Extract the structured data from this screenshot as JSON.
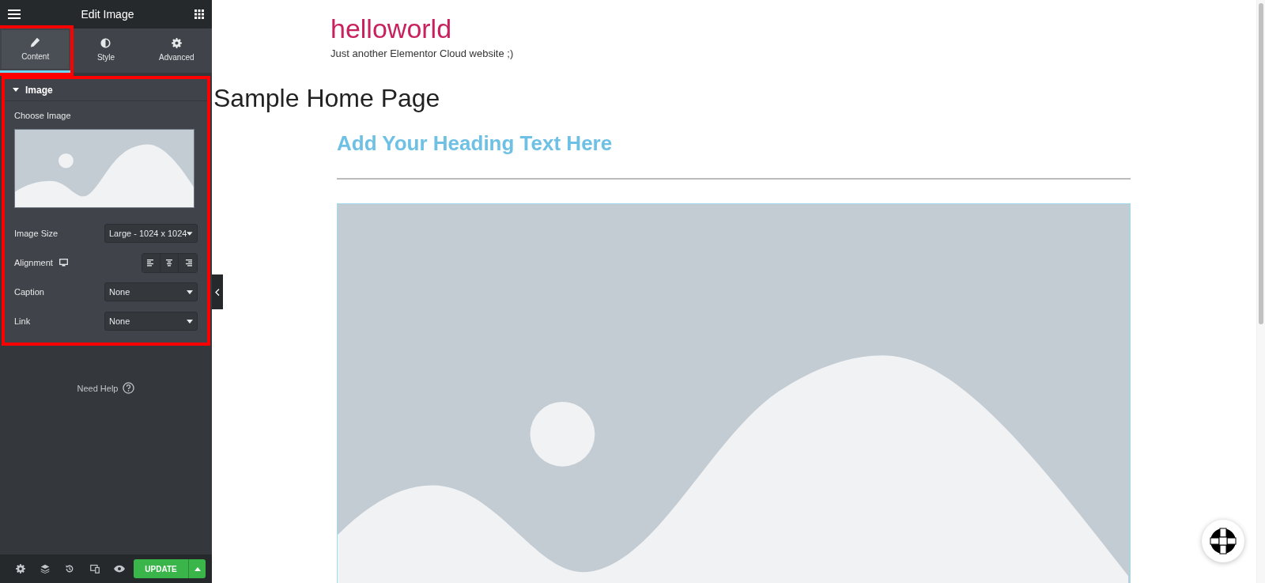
{
  "panel": {
    "title": "Edit Image",
    "tabs": [
      {
        "label": "Content",
        "selected": true,
        "highlighted": true
      },
      {
        "label": "Style",
        "selected": false,
        "highlighted": false
      },
      {
        "label": "Advanced",
        "selected": false,
        "highlighted": false
      }
    ],
    "section": {
      "title": "Image",
      "expanded": true,
      "highlighted": true,
      "choose_label": "Choose Image",
      "controls": [
        {
          "kind": "select",
          "label": "Image Size",
          "value": "Large - 1024 x 1024"
        },
        {
          "kind": "alignment",
          "label": "Alignment"
        },
        {
          "kind": "select",
          "label": "Caption",
          "value": "None"
        },
        {
          "kind": "select",
          "label": "Link",
          "value": "None"
        }
      ]
    },
    "help": "Need Help",
    "footer": {
      "update": "UPDATE"
    }
  },
  "page": {
    "site_title": "helloworld",
    "tagline": "Just another Elementor Cloud website ;)",
    "page_title": "Sample Home Page",
    "heading": "Add Your Heading Text Here"
  }
}
